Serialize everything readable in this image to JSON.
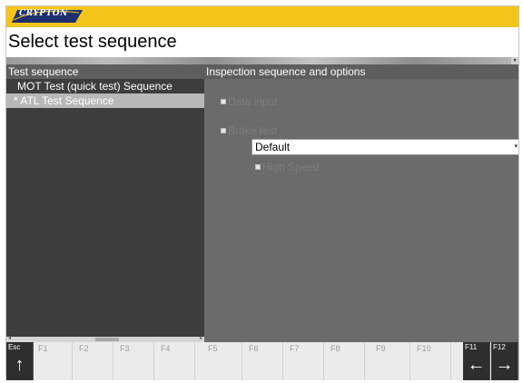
{
  "brand": {
    "logo_text": "CRYPTON",
    "bar_color": "#f3c51b"
  },
  "title": "Select test sequence",
  "left_panel": {
    "header": "Test sequence",
    "items": [
      {
        "label": "MOT Test (quick test) Sequence",
        "selected": false
      },
      {
        "label": "* ATL Test Sequence",
        "selected": true
      }
    ]
  },
  "right_panel": {
    "header": "Inspection sequence and options",
    "options": {
      "data_input": {
        "label": "Data input"
      },
      "brake_test": {
        "label": "Brake test"
      },
      "brake_mode": {
        "value": "Default"
      },
      "high_speed": {
        "label": "High Speed"
      }
    }
  },
  "fkeys": [
    {
      "label": "Esc",
      "icon": "arrow-up-icon",
      "glyph": "↑",
      "active": true
    },
    {
      "label": "F1"
    },
    {
      "label": "F2"
    },
    {
      "label": "F3"
    },
    {
      "label": "F4"
    },
    {
      "label": "F5"
    },
    {
      "label": "F6"
    },
    {
      "label": "F7"
    },
    {
      "label": "F8"
    },
    {
      "label": "F9"
    },
    {
      "label": "F10"
    },
    {
      "label": "F11",
      "icon": "arrow-left-icon",
      "glyph": "←",
      "active": true
    },
    {
      "label": "F12",
      "icon": "arrow-right-icon",
      "glyph": "→",
      "active": true
    }
  ]
}
